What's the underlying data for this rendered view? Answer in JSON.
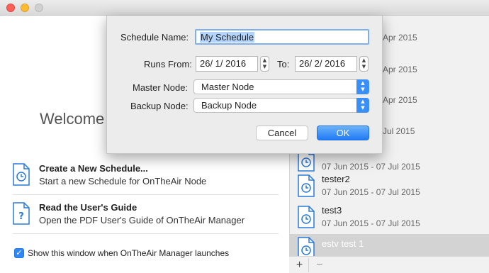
{
  "window": {
    "controls": [
      "close",
      "minimize",
      "zoom"
    ]
  },
  "welcome": {
    "title": "Welcome",
    "actions": [
      {
        "title": "Create a New Schedule...",
        "subtitle": "Start a new Schedule for OnTheAir Node",
        "icon": "schedule-doc-icon"
      },
      {
        "title": "Read the User's Guide",
        "subtitle": "Open the PDF User's Guide of OnTheAir Manager",
        "icon": "help-doc-icon"
      }
    ],
    "show_on_launch": {
      "checked": true,
      "label": "Show this window when OnTheAir Manager launches"
    }
  },
  "schedules": {
    "partial_dates": [
      "Apr 2015",
      "Apr 2015",
      "Apr 2015",
      "Jul 2015"
    ],
    "items": [
      {
        "name": "",
        "dates": "07 Jun 2015 - 07 Jul 2015",
        "selected": false
      },
      {
        "name": "tester2",
        "dates": "07 Jun 2015 - 07 Jul 2015",
        "selected": false
      },
      {
        "name": "test3",
        "dates": "07 Jun 2015 - 07 Jul 2015",
        "selected": false
      },
      {
        "name": "estv test 1",
        "dates": "",
        "selected": true
      }
    ],
    "add_label": "+",
    "remove_label": "−"
  },
  "dialog": {
    "schedule_name_label": "Schedule Name:",
    "schedule_name_value": "My Schedule",
    "runs_from_label": "Runs From:",
    "runs_from_value": "26/  1/ 2016",
    "to_label": "To:",
    "to_value": "26/  2/ 2016",
    "master_node_label": "Master Node:",
    "master_node_value": "Master Node",
    "backup_node_label": "Backup Node:",
    "backup_node_value": "Backup Node",
    "cancel_label": "Cancel",
    "ok_label": "OK",
    "accent_color": "#1f7bf5"
  }
}
